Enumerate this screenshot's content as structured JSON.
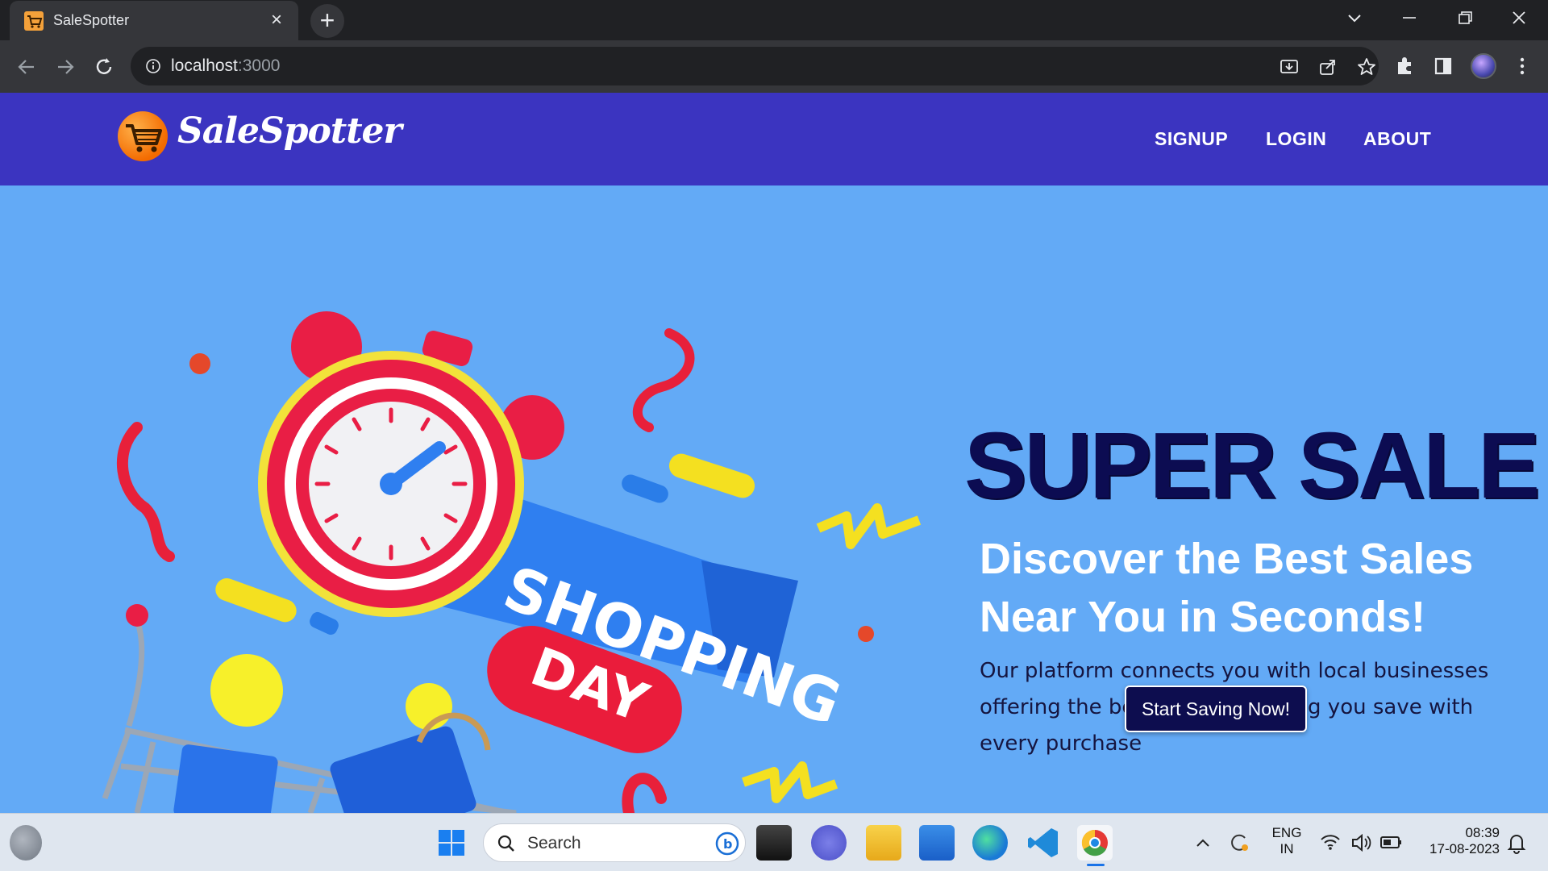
{
  "browser": {
    "tab_title": "SaleSpotter",
    "url_host": "localhost",
    "url_port": ":3000"
  },
  "site": {
    "brand": "SaleSpotter",
    "nav": [
      "SIGNUP",
      "LOGIN",
      "ABOUT"
    ],
    "hero_art": {
      "banner_line1": "SHOPPING",
      "banner_line2": "DAY"
    },
    "headline": "SUPER SALE",
    "subhead": "Discover the Best Sales Near You in Seconds!",
    "body": "Our platform connects you with local businesses offering the best deals, ensuring you save with every purchase",
    "cta": "Start Saving Now!"
  },
  "taskbar": {
    "search_label": "Search",
    "lang_line1": "ENG",
    "lang_line2": "IN",
    "time": "08:39",
    "date": "17-08-2023"
  },
  "colors": {
    "header_bg": "#3b34c0",
    "hero_bg": "#63aaf6",
    "headline": "#0c0c52",
    "cta_bg": "#0d0d4f"
  }
}
